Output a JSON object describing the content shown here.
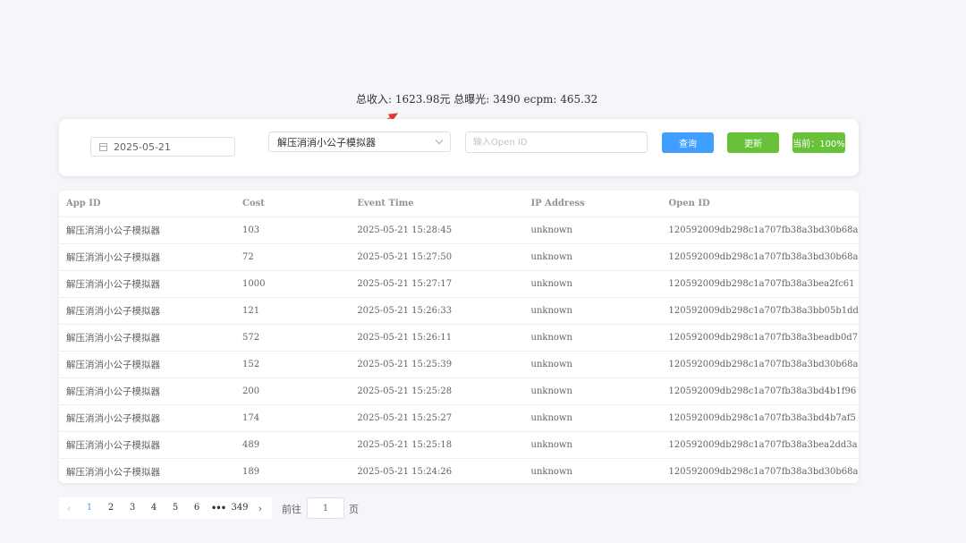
{
  "summary": {
    "text": "总收入: 1623.98元 总曝光: 3490 ecpm: 465.32"
  },
  "filters": {
    "date_value": "2025-05-21",
    "app_select_value": "解压消消小公子模拟器",
    "openid_placeholder": "输入Open ID",
    "query_label": "查询",
    "update_label": "更新",
    "progress_label": "当前：100%"
  },
  "colors": {
    "primary": "#409eff",
    "success": "#67c23a",
    "annotation_arrow": "#e8392b"
  },
  "table": {
    "headers": [
      "App ID",
      "Cost",
      "Event Time",
      "IP Address",
      "Open ID"
    ],
    "rows": [
      [
        "解压消消小公子模拟器",
        "103",
        "2025-05-21 15:28:45",
        "unknown",
        "120592009db298c1a707fb38a3bd30b68a"
      ],
      [
        "解压消消小公子模拟器",
        "72",
        "2025-05-21 15:27:50",
        "unknown",
        "120592009db298c1a707fb38a3bd30b68a"
      ],
      [
        "解压消消小公子模拟器",
        "1000",
        "2025-05-21 15:27:17",
        "unknown",
        "120592009db298c1a707fb38a3bea2fc61"
      ],
      [
        "解压消消小公子模拟器",
        "121",
        "2025-05-21 15:26:33",
        "unknown",
        "120592009db298c1a707fb38a3bb05b1dd"
      ],
      [
        "解压消消小公子模拟器",
        "572",
        "2025-05-21 15:26:11",
        "unknown",
        "120592009db298c1a707fb38a3beadb0d7"
      ],
      [
        "解压消消小公子模拟器",
        "152",
        "2025-05-21 15:25:39",
        "unknown",
        "120592009db298c1a707fb38a3bd30b68a"
      ],
      [
        "解压消消小公子模拟器",
        "200",
        "2025-05-21 15:25:28",
        "unknown",
        "120592009db298c1a707fb38a3bd4b1f96"
      ],
      [
        "解压消消小公子模拟器",
        "174",
        "2025-05-21 15:25:27",
        "unknown",
        "120592009db298c1a707fb38a3bd4b7af5"
      ],
      [
        "解压消消小公子模拟器",
        "489",
        "2025-05-21 15:25:18",
        "unknown",
        "120592009db298c1a707fb38a3bea2dd3a"
      ],
      [
        "解压消消小公子模拟器",
        "189",
        "2025-05-21 15:24:26",
        "unknown",
        "120592009db298c1a707fb38a3bd30b68a"
      ]
    ]
  },
  "pagination": {
    "pages": [
      "1",
      "2",
      "3",
      "4",
      "5",
      "6"
    ],
    "current": "1",
    "ellipsis": "•••",
    "last_page": "349",
    "prev_icon": "chevron-left-icon",
    "next_icon": "chevron-right-icon",
    "goto_label": "前往",
    "goto_value": "1",
    "goto_suffix": "页"
  }
}
